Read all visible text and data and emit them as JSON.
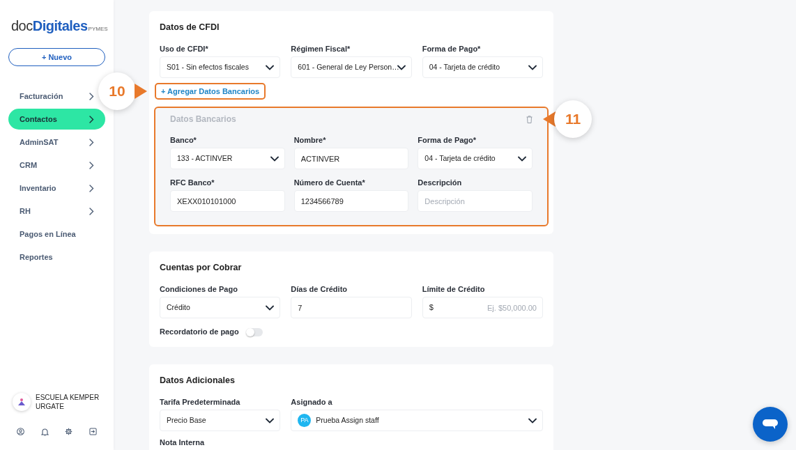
{
  "sidebar": {
    "logo": {
      "part_1": "doc",
      "part_2": "Digitales",
      "part_3": "PYMES"
    },
    "new_button": "+ Nuevo",
    "items": [
      {
        "label": "Facturación",
        "expandable": true,
        "selected": false
      },
      {
        "label": "Contactos",
        "expandable": true,
        "selected": true
      },
      {
        "label": "AdminSAT",
        "expandable": true,
        "selected": false
      },
      {
        "label": "CRM",
        "expandable": true,
        "selected": false
      },
      {
        "label": "Inventario",
        "expandable": true,
        "selected": false
      },
      {
        "label": "RH",
        "expandable": true,
        "selected": false
      },
      {
        "label": "Pagos en Línea",
        "expandable": false,
        "selected": false
      },
      {
        "label": "Reportes",
        "expandable": false,
        "selected": false
      }
    ],
    "account": {
      "name": "ESCUELA KEMPER URGATE"
    }
  },
  "cfdi": {
    "title": "Datos de CFDI",
    "fields": [
      {
        "kind": "select",
        "label": "Uso de CFDI*",
        "value": "S01 - Sin efectos fiscales"
      },
      {
        "kind": "select",
        "label": "Régimen Fiscal*",
        "value": "601 - General de Ley Person…"
      },
      {
        "kind": "select",
        "label": "Forma de Pago*",
        "value": "04 - Tarjeta de crédito"
      }
    ],
    "add_link": {
      "label": "+ Agregar Datos Bancarios",
      "highlighted": true
    },
    "bank": {
      "title": "Datos Bancarios",
      "highlighted": true,
      "fields": [
        {
          "kind": "select",
          "label": "Banco*",
          "value": "133 - ACTINVER"
        },
        {
          "kind": "text",
          "label": "Nombre*",
          "value": "ACTINVER"
        },
        {
          "kind": "select",
          "label": "Forma de Pago*",
          "value": "04 - Tarjeta de crédito"
        },
        {
          "kind": "text",
          "label": "RFC Banco*",
          "value": "XEXX010101000"
        },
        {
          "kind": "text",
          "label": "Número de Cuenta*",
          "value": "1234566789"
        },
        {
          "kind": "text",
          "label": "Descripción",
          "placeholder": "Descripción"
        }
      ]
    }
  },
  "receivables": {
    "title": "Cuentas por Cobrar",
    "fields": [
      {
        "kind": "select",
        "label": "Condiciones de Pago",
        "value": "Crédito"
      },
      {
        "kind": "text",
        "label": "Días de Crédito",
        "value": "7"
      },
      {
        "kind": "money",
        "label": "Límite de Crédito",
        "prefix": "$",
        "placeholder": "Ej. $50,000.00"
      }
    ],
    "reminder": {
      "label": "Recordatorio de pago",
      "on": false
    }
  },
  "additional": {
    "title": "Datos Adicionales",
    "fields": [
      {
        "kind": "select",
        "label": "Tarifa Predeterminada",
        "value": "Precio Base"
      },
      {
        "kind": "person_select",
        "label": "Asignado a",
        "initials": "PA",
        "value": "Prueba Assign staff"
      }
    ],
    "note_label": "Nota Interna"
  },
  "callouts": [
    {
      "label": "10"
    },
    {
      "label": "11"
    }
  ]
}
